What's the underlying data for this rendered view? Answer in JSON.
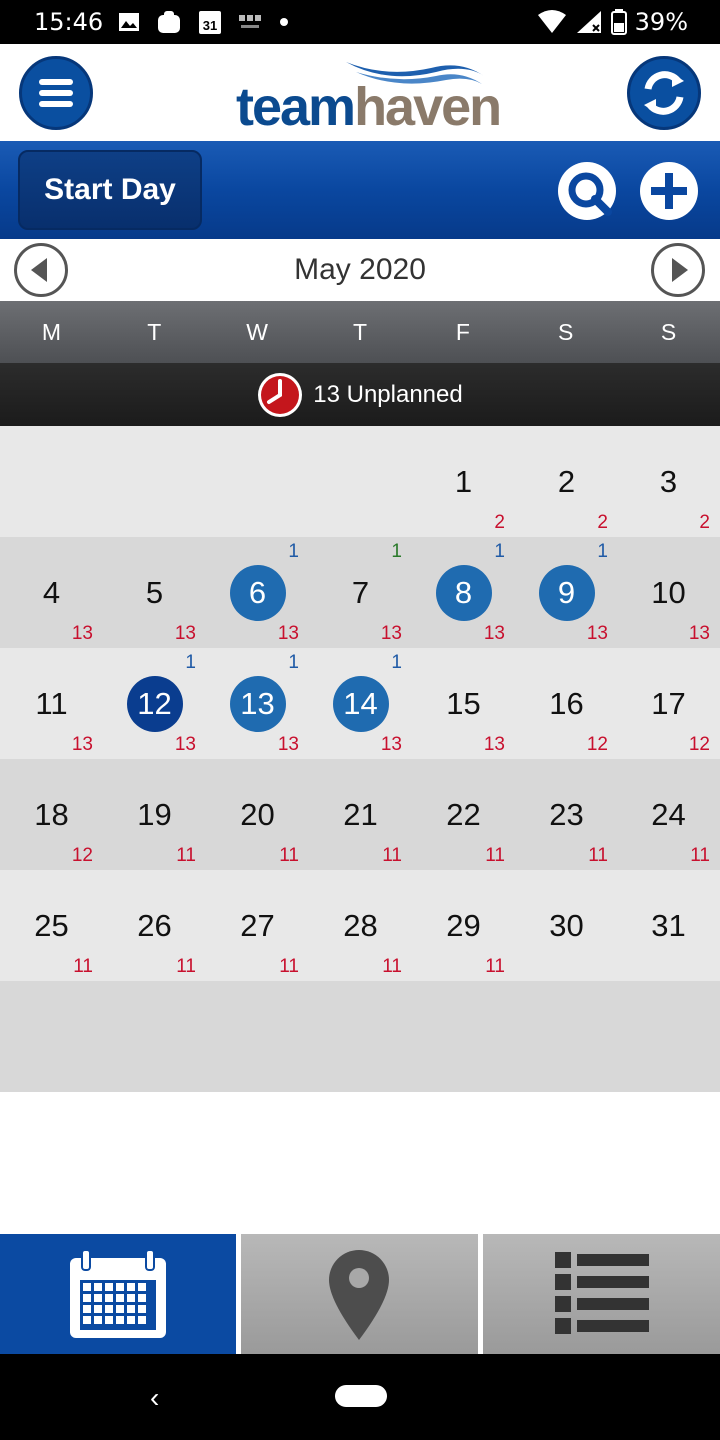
{
  "status_bar": {
    "time": "15:46",
    "battery": "39%",
    "icons": [
      "image-icon",
      "bag-icon",
      "calendar-31-icon",
      "bbc-news-icon",
      "dot-icon",
      "wifi-icon",
      "signal-icon",
      "battery-icon"
    ],
    "calendar_badge": "31"
  },
  "header": {
    "logo_team": "team",
    "logo_haven": "haven",
    "menu_icon": "hamburger-menu-icon",
    "sync_icon": "sync-icon"
  },
  "toolbar": {
    "start_day_label": "Start Day",
    "search_icon": "search-icon",
    "add_icon": "add-icon"
  },
  "month_nav": {
    "title": "May 2020",
    "prev_icon": "chevron-left-icon",
    "next_icon": "chevron-right-icon"
  },
  "weekdays": [
    "M",
    "T",
    "W",
    "T",
    "F",
    "S",
    "S"
  ],
  "unplanned": {
    "text": "13 Unplanned",
    "icon": "clock-icon"
  },
  "calendar": {
    "weeks": [
      [
        null,
        null,
        null,
        null,
        {
          "day": "1",
          "red": "2"
        },
        {
          "day": "2",
          "red": "2"
        },
        {
          "day": "3",
          "red": "2"
        }
      ],
      [
        {
          "day": "4",
          "red": "13"
        },
        {
          "day": "5",
          "red": "13"
        },
        {
          "day": "6",
          "red": "13",
          "blue": "1",
          "state": "sel"
        },
        {
          "day": "7",
          "red": "13",
          "green": "1"
        },
        {
          "day": "8",
          "red": "13",
          "blue": "1",
          "state": "sel"
        },
        {
          "day": "9",
          "red": "13",
          "blue": "1",
          "state": "sel"
        },
        {
          "day": "10",
          "red": "13"
        }
      ],
      [
        {
          "day": "11",
          "red": "13"
        },
        {
          "day": "12",
          "red": "13",
          "blue": "1",
          "state": "today"
        },
        {
          "day": "13",
          "red": "13",
          "blue": "1",
          "state": "sel"
        },
        {
          "day": "14",
          "red": "13",
          "blue": "1",
          "state": "sel"
        },
        {
          "day": "15",
          "red": "13"
        },
        {
          "day": "16",
          "red": "12"
        },
        {
          "day": "17",
          "red": "12"
        }
      ],
      [
        {
          "day": "18",
          "red": "12"
        },
        {
          "day": "19",
          "red": "11"
        },
        {
          "day": "20",
          "red": "11"
        },
        {
          "day": "21",
          "red": "11"
        },
        {
          "day": "22",
          "red": "11"
        },
        {
          "day": "23",
          "red": "11"
        },
        {
          "day": "24",
          "red": "11"
        }
      ],
      [
        {
          "day": "25",
          "red": "11"
        },
        {
          "day": "26",
          "red": "11"
        },
        {
          "day": "27",
          "red": "11"
        },
        {
          "day": "28",
          "red": "11"
        },
        {
          "day": "29",
          "red": "11"
        },
        {
          "day": "30"
        },
        {
          "day": "31"
        }
      ],
      [
        null,
        null,
        null,
        null,
        null,
        null,
        null
      ]
    ]
  },
  "tabs": [
    {
      "name": "calendar",
      "icon": "calendar-icon",
      "active": true
    },
    {
      "name": "map",
      "icon": "map-pin-icon",
      "active": false
    },
    {
      "name": "list",
      "icon": "list-icon",
      "active": false
    }
  ],
  "nav_bar": {
    "back_glyph": "‹"
  },
  "colors": {
    "brand_blue": "#0a4fa0",
    "selected_day": "#1f6bb0",
    "today_day": "#0a3d8f",
    "count_red": "#c8102e",
    "count_blue": "#1f5aa6",
    "count_green": "#2a7a2a"
  }
}
